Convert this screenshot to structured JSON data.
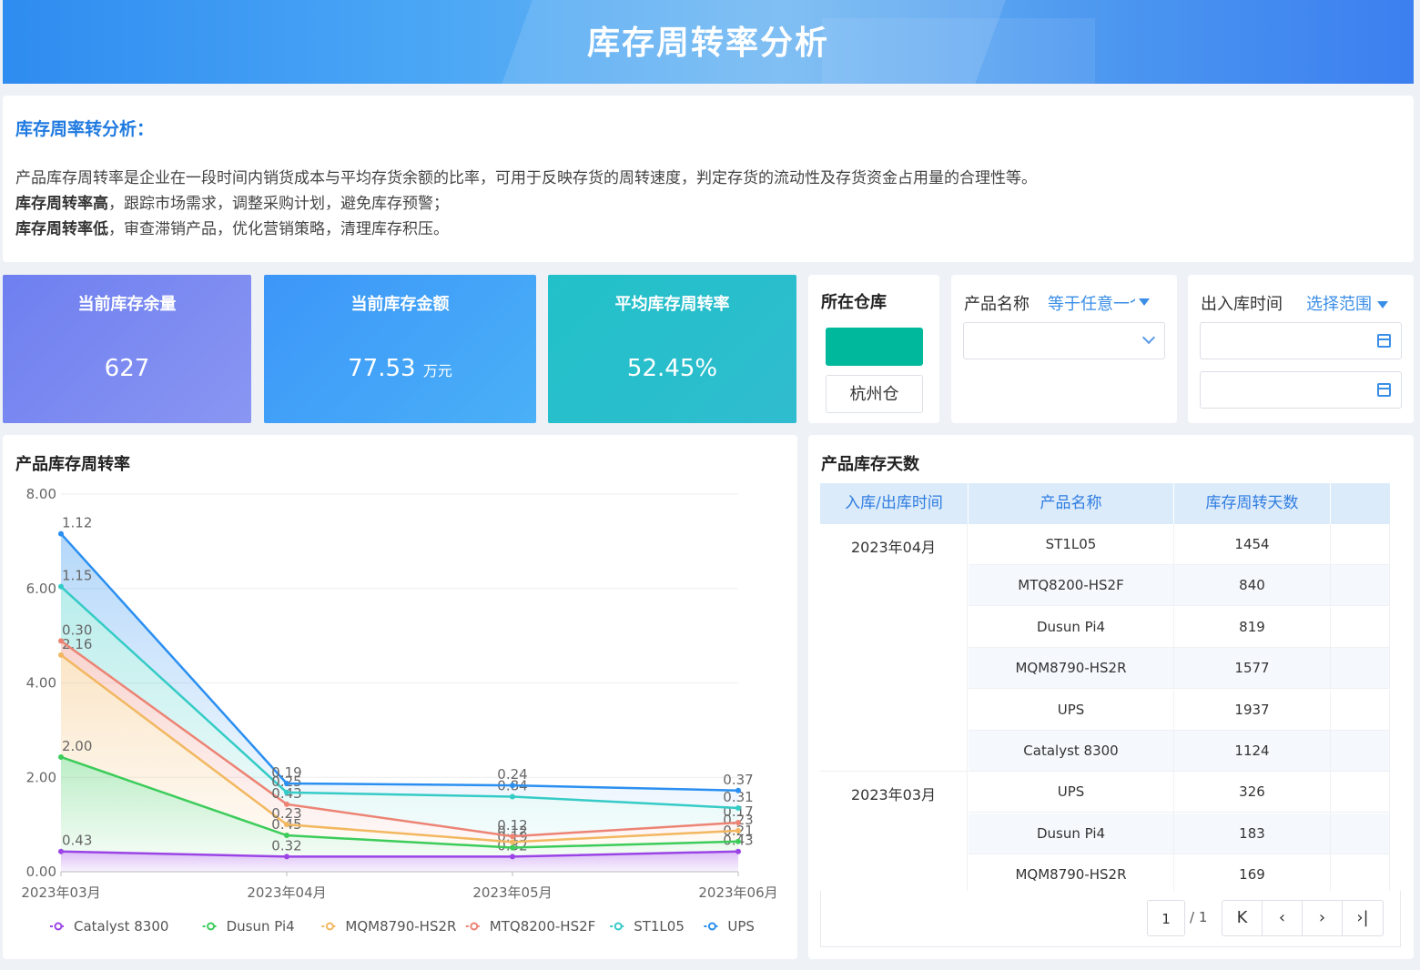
{
  "header": {
    "title": "库存周转率分析"
  },
  "intro": {
    "title": "库存周率转分析：",
    "line1": "产品库存周转率是企业在一段时间内销货成本与平均存货余额的比率，可用于反映存货的周转速度，判定存货的流动性及存货资金占用量的合理性等。",
    "line2_bold": "库存周转率高",
    "line2_rest": "，跟踪市场需求，调整采购计划，避免库存预警；",
    "line3_bold": "库存周转率低",
    "line3_rest": "，审查滞销产品，优化营销策略，清理库存积压。"
  },
  "kpis": {
    "stock_qty": {
      "label": "当前库存余量",
      "value": "627"
    },
    "stock_amount": {
      "label": "当前库存金额",
      "value": "77.53",
      "unit": "万元"
    },
    "avg_turnover": {
      "label": "平均库存周转率",
      "value": "52.45%"
    }
  },
  "warehouse": {
    "label": "所在仓库",
    "selected": "杭州仓",
    "accent": "#00b89c"
  },
  "product_filter": {
    "label": "产品名称",
    "operator": "等于任意一个",
    "value": ""
  },
  "date_filter": {
    "label": "出入库时间",
    "operator": "选择范围",
    "start": "",
    "end": ""
  },
  "chart_title": "产品库存周转率",
  "chart_data": {
    "type": "area",
    "categories": [
      "2023年03月",
      "2023年04月",
      "2023年05月",
      "2023年06月"
    ],
    "ylim": [
      0,
      8
    ],
    "yticks": [
      "0.00",
      "2.00",
      "4.00",
      "6.00",
      "8.00"
    ],
    "stacked": true,
    "series": [
      {
        "name": "Catalyst 8300",
        "color": "#9b44e6",
        "values": [
          0.43,
          0.32,
          0.32,
          0.43
        ],
        "labels": [
          "0.43",
          "0.32",
          "0.32",
          "0.43"
        ]
      },
      {
        "name": "Dusun Pi4",
        "color": "#3ccc5a",
        "values": [
          2.0,
          0.45,
          0.19,
          0.21
        ],
        "labels": [
          "2.00",
          "0.45",
          "0.19",
          "0.21"
        ]
      },
      {
        "name": "MQM8790-HS2R",
        "color": "#f2b760",
        "values": [
          2.16,
          0.23,
          0.12,
          0.23
        ],
        "labels": [
          "2.16",
          "0.23",
          "0.12",
          "0.23"
        ]
      },
      {
        "name": "MTQ8200-HS2F",
        "color": "#ec8374",
        "values": [
          0.3,
          0.43,
          0.12,
          0.17
        ],
        "labels": [
          "0.30",
          "0.43",
          "0.12",
          "0.17"
        ]
      },
      {
        "name": "ST1L05",
        "color": "#35cbc6",
        "values": [
          1.15,
          0.25,
          0.84,
          0.31
        ],
        "labels": [
          "1.15",
          "0.25",
          "0.84",
          "0.31"
        ]
      },
      {
        "name": "UPS",
        "color": "#2a8ff0",
        "values": [
          1.12,
          0.19,
          0.24,
          0.37
        ],
        "labels": [
          "1.12",
          "0.19",
          "0.24",
          "0.37"
        ]
      }
    ]
  },
  "table": {
    "title": "产品库存天数",
    "columns": [
      "入库/出库时间",
      "产品名称",
      "库存周转天数"
    ],
    "groups": [
      {
        "period": "2023年04月",
        "rows": [
          {
            "product": "ST1L05",
            "days": "1454"
          },
          {
            "product": "MTQ8200-HS2F",
            "days": "840"
          },
          {
            "product": "Dusun Pi4",
            "days": "819"
          },
          {
            "product": "MQM8790-HS2R",
            "days": "1577"
          },
          {
            "product": "UPS",
            "days": "1937"
          },
          {
            "product": "Catalyst 8300",
            "days": "1124"
          }
        ]
      },
      {
        "period": "2023年03月",
        "rows": [
          {
            "product": "UPS",
            "days": "326"
          },
          {
            "product": "Dusun Pi4",
            "days": "183"
          },
          {
            "product": "MQM8790-HS2R",
            "days": "169"
          }
        ]
      }
    ]
  },
  "pager": {
    "page": "1",
    "total": "/ 1",
    "first": "K",
    "prev": "‹",
    "next": "›",
    "last": "›|"
  }
}
